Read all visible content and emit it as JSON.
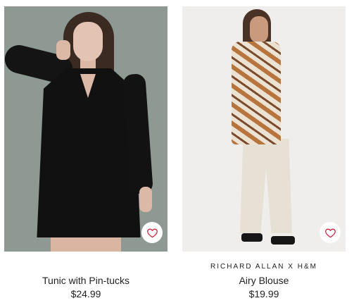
{
  "products": [
    {
      "brand": "",
      "name": "Tunic with Pin-tucks",
      "price": "$24.99",
      "favorite_icon": "heart-outline-icon",
      "image_background": "#8f9994"
    },
    {
      "brand": "RICHARD ALLAN X H&M",
      "name": "Airy Blouse",
      "price": "$19.99",
      "favorite_icon": "heart-outline-icon",
      "image_background": "#efeeec"
    }
  ],
  "colors": {
    "heart": "#d1213c",
    "text": "#222222"
  }
}
